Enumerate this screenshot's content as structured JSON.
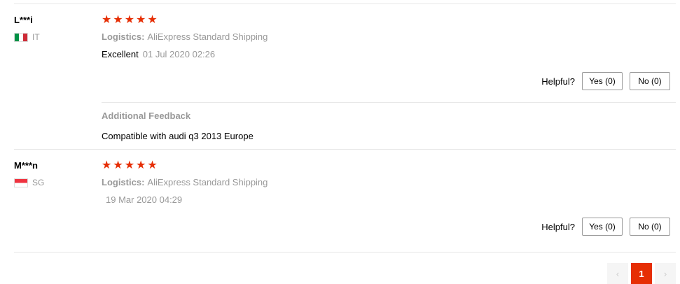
{
  "colors": {
    "star": "#e62e04",
    "active_page": "#e62e04"
  },
  "reviews": [
    {
      "user": "L***i",
      "country": "IT",
      "flag_icon": "italy-flag-icon",
      "stars": 5,
      "logistics_label": "Logistics:",
      "logistics_value": "AliExpress Standard Shipping",
      "comment": "Excellent",
      "date": "01 Jul 2020 02:26",
      "helpful_label": "Helpful?",
      "yes_label": "Yes (0)",
      "no_label": "No (0)",
      "additional_title": "Additional Feedback",
      "additional_text": "Compatible with audi q3 2013 Europe"
    },
    {
      "user": "M***n",
      "country": "SG",
      "flag_icon": "singapore-flag-icon",
      "stars": 5,
      "logistics_label": "Logistics:",
      "logistics_value": "AliExpress Standard Shipping",
      "comment": "",
      "date": "19 Mar 2020 04:29",
      "helpful_label": "Helpful?",
      "yes_label": "Yes (0)",
      "no_label": "No (0)"
    }
  ],
  "pagination": {
    "prev_icon": "chevron-left-icon",
    "prev_glyph": "‹",
    "current_page": "1",
    "next_icon": "chevron-right-icon",
    "next_glyph": "›"
  }
}
